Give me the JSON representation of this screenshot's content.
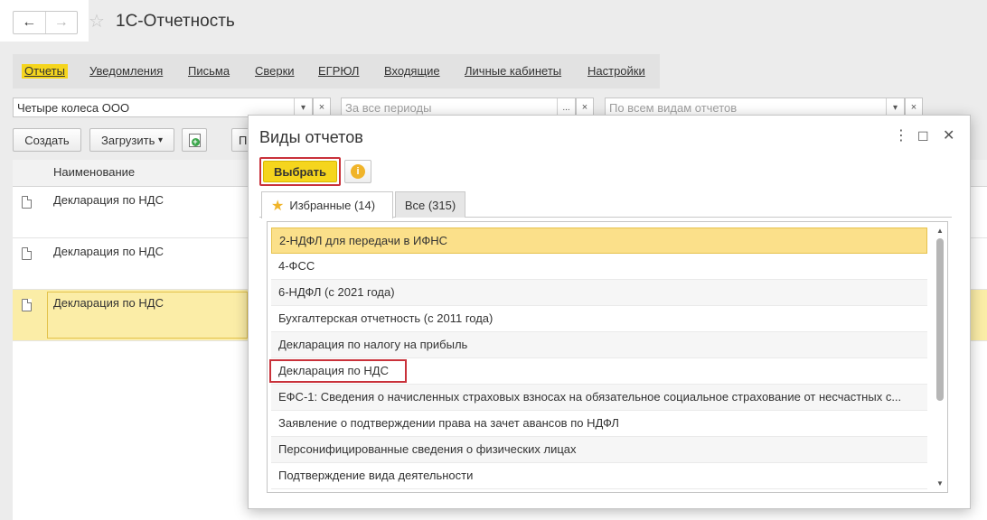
{
  "header": {
    "back_icon": "arrow-left-icon",
    "forward_icon": "arrow-right-icon",
    "favorite_icon": "star-icon",
    "title": "1С-Отчетность"
  },
  "menu": {
    "items": [
      {
        "label": "Отчеты",
        "active": true
      },
      {
        "label": "Уведомления"
      },
      {
        "label": "Письма"
      },
      {
        "label": "Сверки"
      },
      {
        "label": "ЕГРЮЛ"
      },
      {
        "label": "Входящие"
      },
      {
        "label": "Личные кабинеты"
      },
      {
        "label": "Настройки"
      }
    ]
  },
  "filters": {
    "organization": "Четыре колеса ООО",
    "period_placeholder": "За все периоды",
    "report_kind_placeholder": "По всем видам отчетов",
    "dropdown_glyph": "▾",
    "ellipsis_glyph": "...",
    "clear_glyph": "×"
  },
  "toolbar": {
    "create_label": "Создать",
    "load_label": "Загрузить",
    "load_arrow": "▾",
    "add_icon": "add-document-icon",
    "partial_label": "П"
  },
  "list": {
    "column_name": "Наименование",
    "rows": [
      {
        "name": "Декларация по НДС"
      },
      {
        "name": "Декларация по НДС"
      },
      {
        "name": "Декларация по НДС",
        "selected": true
      }
    ]
  },
  "dialog": {
    "title": "Виды отчетов",
    "more_icon": "⋮",
    "maximize_icon": "☐",
    "close_icon": "✕",
    "choose_label": "Выбрать",
    "info_icon": "i",
    "tabs": [
      {
        "label": "Избранные (14)",
        "active": true
      },
      {
        "label": "Все (315)"
      }
    ],
    "items": [
      {
        "label": "2-НДФЛ для передачи в ИФНС",
        "highlighted": true
      },
      {
        "label": "4-ФСС"
      },
      {
        "label": "6-НДФЛ (с 2021 года)"
      },
      {
        "label": "Бухгалтерская отчетность (с 2011 года)"
      },
      {
        "label": "Декларация по налогу на прибыль"
      },
      {
        "label": "Декларация по НДС",
        "framed": true
      },
      {
        "label": "ЕФС-1: Сведения о начисленных страховых взносах на обязательное социальное страхование от несчастных с..."
      },
      {
        "label": "Заявление о подтверждении права на зачет авансов по НДФЛ"
      },
      {
        "label": "Персонифицированные сведения о физических лицах"
      },
      {
        "label": "Подтверждение вида деятельности"
      }
    ],
    "scroll_up": "▲",
    "scroll_down": "▼"
  },
  "colors": {
    "accent_yellow": "#f5d51d",
    "selection_row": "#fbeda7",
    "highlight_row": "#fbe08a",
    "red_frame": "#c9313a"
  }
}
